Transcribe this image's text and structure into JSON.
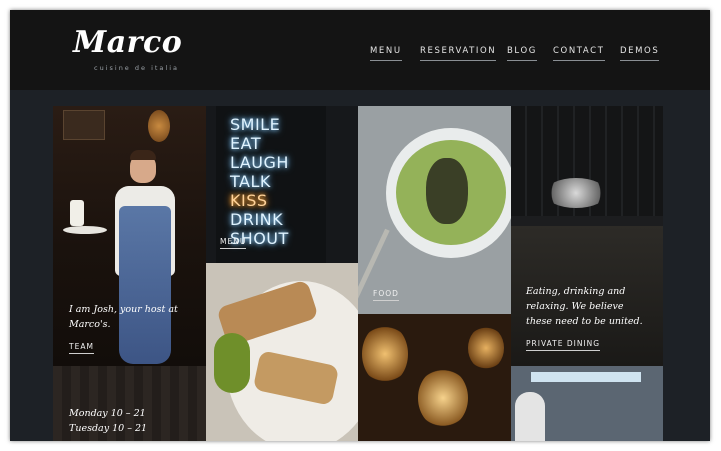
{
  "header": {
    "logo": "Marco",
    "tagline": "cuisine de italia",
    "nav": [
      {
        "label": "MENU"
      },
      {
        "label": "RESERVATION"
      },
      {
        "label": "BLOG"
      },
      {
        "label": "CONTACT"
      },
      {
        "label": "DEMOS"
      }
    ]
  },
  "tiles": {
    "team": {
      "caption": "I am Josh, your host at Marco's.",
      "link": "TEAM"
    },
    "menu": {
      "link": "MENU",
      "neon": [
        "SMILE",
        "EAT",
        "LAUGH",
        "TALK",
        "KISS",
        "DRINK",
        "SHOUT"
      ]
    },
    "food": {
      "link": "FOOD"
    },
    "private": {
      "caption": "Eating, drinking and relaxing. We believe these need to be united.",
      "link": "PRIVATE DINING"
    },
    "hours": [
      "Monday 10 – 21",
      "Tuesday 10 – 21"
    ]
  },
  "colors": {
    "header_bg": "#141414",
    "page_bg": "#1d2126",
    "neon_blue": "#dff3ff",
    "neon_amber": "#ffd39a"
  }
}
